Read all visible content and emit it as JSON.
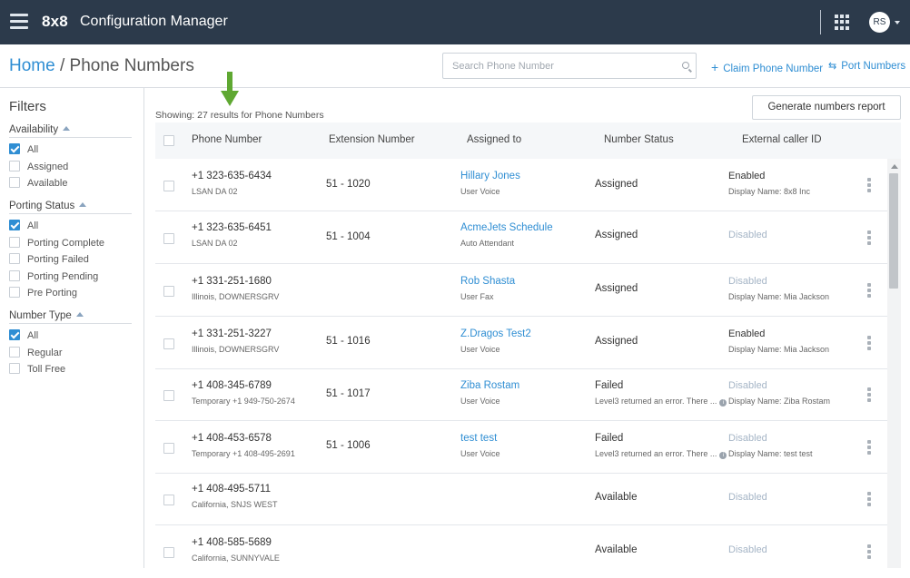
{
  "topbar": {
    "logo": "8x8",
    "title": "Configuration Manager",
    "avatar_initials": "RS"
  },
  "breadcrumb": {
    "home": "Home",
    "separator": " / ",
    "current": "Phone Numbers"
  },
  "search": {
    "placeholder": "Search Phone Number"
  },
  "actions": {
    "claim": "Claim Phone Number",
    "port": "Port Numbers",
    "generate": "Generate numbers report"
  },
  "filters": {
    "title": "Filters",
    "groups": [
      {
        "label": "Availability",
        "options": [
          {
            "label": "All",
            "checked": true
          },
          {
            "label": "Assigned",
            "checked": false
          },
          {
            "label": "Available",
            "checked": false
          }
        ]
      },
      {
        "label": "Porting Status",
        "options": [
          {
            "label": "All",
            "checked": true
          },
          {
            "label": "Porting Complete",
            "checked": false
          },
          {
            "label": "Porting Failed",
            "checked": false
          },
          {
            "label": "Porting Pending",
            "checked": false
          },
          {
            "label": "Pre Porting",
            "checked": false
          }
        ]
      },
      {
        "label": "Number Type",
        "options": [
          {
            "label": "All",
            "checked": true
          },
          {
            "label": "Regular",
            "checked": false
          },
          {
            "label": "Toll Free",
            "checked": false
          }
        ]
      }
    ]
  },
  "results_text": "Showing: 27 results for Phone Numbers",
  "table": {
    "columns": [
      "Phone Number",
      "Extension Number",
      "Assigned to",
      "Number Status",
      "External caller ID"
    ],
    "rows": [
      {
        "phone": "+1 323-635-6434",
        "location": "LSAN DA 02",
        "ext": "51 - 1020",
        "assignee": "Hillary Jones",
        "assignee_type": "User Voice",
        "status": "Assigned",
        "status_note": "",
        "caller": "Enabled",
        "caller_name": "Display Name: 8x8 Inc"
      },
      {
        "phone": "+1 323-635-6451",
        "location": "LSAN DA 02",
        "ext": "51 - 1004",
        "assignee": "AcmeJets Schedule",
        "assignee_type": "Auto Attendant",
        "status": "Assigned",
        "status_note": "",
        "caller": "Disabled",
        "caller_name": ""
      },
      {
        "phone": "+1 331-251-1680",
        "location": "Illinois, DOWNERSGRV",
        "ext": "",
        "assignee": "Rob Shasta",
        "assignee_type": "User Fax",
        "status": "Assigned",
        "status_note": "",
        "caller": "Disabled",
        "caller_name": "Display Name: Mia Jackson"
      },
      {
        "phone": "+1 331-251-3227",
        "location": "Illinois, DOWNERSGRV",
        "ext": "51 - 1016",
        "assignee": "Z.Dragos Test2",
        "assignee_type": "User Voice",
        "status": "Assigned",
        "status_note": "",
        "caller": "Enabled",
        "caller_name": "Display Name: Mia Jackson"
      },
      {
        "phone": "+1 408-345-6789",
        "location": "Temporary +1 949-750-2674",
        "ext": "51 - 1017",
        "assignee": "Ziba Rostam",
        "assignee_type": "User Voice",
        "status": "Failed",
        "status_note": "Level3 returned an error. There ...",
        "caller": "Disabled",
        "caller_name": "Display Name: Ziba Rostam"
      },
      {
        "phone": "+1 408-453-6578",
        "location": "Temporary +1 408-495-2691",
        "ext": "51 - 1006",
        "assignee": "test test",
        "assignee_type": "User Voice",
        "status": "Failed",
        "status_note": "Level3 returned an error. There ...",
        "caller": "Disabled",
        "caller_name": "Display Name: test test"
      },
      {
        "phone": "+1 408-495-5711",
        "location": "California, SNJS WEST",
        "ext": "",
        "assignee": "",
        "assignee_type": "",
        "status": "Available",
        "status_note": "",
        "caller": "Disabled",
        "caller_name": ""
      },
      {
        "phone": "+1 408-585-5689",
        "location": "California, SUNNYVALE",
        "ext": "",
        "assignee": "",
        "assignee_type": "",
        "status": "Available",
        "status_note": "",
        "caller": "Disabled",
        "caller_name": ""
      }
    ]
  },
  "colors": {
    "topbar": "#2c3a4b",
    "accent": "#2f8ed3",
    "disabled_text": "#a5b5c6",
    "arrow": "#5fa832"
  }
}
